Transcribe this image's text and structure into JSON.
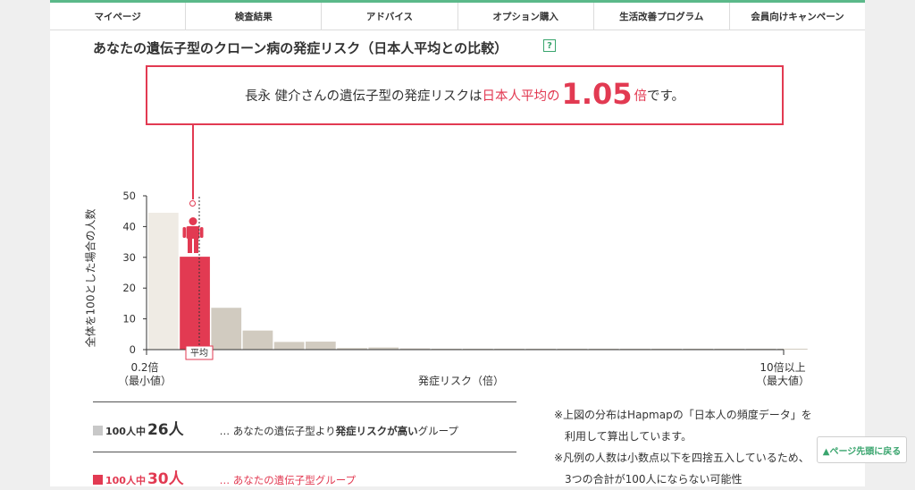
{
  "nav": {
    "items": [
      {
        "label": "マイページ"
      },
      {
        "label": "検査結果"
      },
      {
        "label": "アドバイス"
      },
      {
        "label": "オプション購入"
      },
      {
        "label": "生活改善プログラム"
      },
      {
        "label": "会員向けキャンペーン"
      }
    ]
  },
  "header": {
    "title": "あなたの遺伝子型のクローン病の発症リスク（日本人平均との比較）",
    "help_label": "?"
  },
  "callout": {
    "name": "長永 健介",
    "text_a": "さんの遺伝子型の発症リスクは",
    "text_b": "日本人平均の",
    "value": "1.05",
    "text_c": "倍",
    "text_d": "です。"
  },
  "chart_data": {
    "type": "bar",
    "ylabel": "全体を100とした場合の人数",
    "xlabel": "発症リスク（倍）",
    "x_min_label": "0.2倍",
    "x_min_sub": "（最小値）",
    "x_max_label": "10倍以上",
    "x_max_sub": "（最大値）",
    "ylim": [
      0,
      50
    ],
    "yticks": [
      "0",
      "10",
      "20",
      "30",
      "40",
      "50"
    ],
    "values": [
      44.5,
      30.2,
      13.6,
      6.2,
      2.5,
      2.6,
      0.5,
      0.7,
      0.4,
      0.3,
      0.3,
      0.3,
      0.3,
      0.3,
      0.3,
      0.3,
      0.3,
      0.3,
      0.3,
      0.3,
      0.3
    ],
    "highlight_index": 1,
    "average_label": "平均",
    "colors": {
      "highlight": "#e23a52",
      "low": "#efebe4",
      "high": "#d1cbc0"
    }
  },
  "legend": {
    "rows": [
      {
        "prefix": "100人中",
        "count": "26人",
        "desc_a": "… あなたの遺伝子型より",
        "desc_b": "発症リスクが高い",
        "desc_c": "グループ",
        "color": "#c8c8c8"
      },
      {
        "prefix": "100人中",
        "count": "30人",
        "desc_a": "… あなたの遺伝子型グループ",
        "desc_b": "",
        "desc_c": "",
        "color": "#e23a52"
      }
    ]
  },
  "notes": [
    "※上図の分布はHapmapの「日本人の頻度データ」を利用して算出しています。",
    "※凡例の人数は小数点以下を四捨五入しているため、3つの合計が100人にならない可能性"
  ],
  "page_top": {
    "label": "▲ページ先頭に戻る"
  }
}
